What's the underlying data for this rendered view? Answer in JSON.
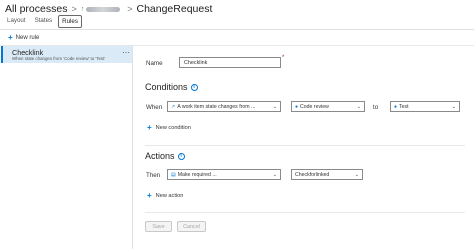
{
  "breadcrumb": {
    "root": "All processes",
    "separator": ">",
    "current": "ChangeRequest"
  },
  "tabs": [
    {
      "label": "Layout"
    },
    {
      "label": "States"
    },
    {
      "label": "Rules",
      "active": true
    }
  ],
  "toolbar": {
    "new_rule_label": "New rule"
  },
  "rules_list": [
    {
      "title": "Checklink",
      "description": "When state changes from 'Code review' to 'Test'",
      "more": "⋯"
    }
  ],
  "form": {
    "name_label": "Name",
    "name_value": "Checklink",
    "required_marker": "*",
    "conditions": {
      "heading": "Conditions",
      "when_label": "When",
      "condition_select": "A work item state changes from ...",
      "from_value": "Code review",
      "to_label": "to",
      "to_value": "Test",
      "new_condition_label": "New condition"
    },
    "actions": {
      "heading": "Actions",
      "then_label": "Then",
      "action_select": "Make required ...",
      "field_value": "Checkforlinked",
      "new_action_label": "New action"
    },
    "save_label": "Save",
    "cancel_label": "Cancel"
  },
  "colors": {
    "accent": "#0078d4",
    "selected_row_bg": "#dbeaf7"
  }
}
